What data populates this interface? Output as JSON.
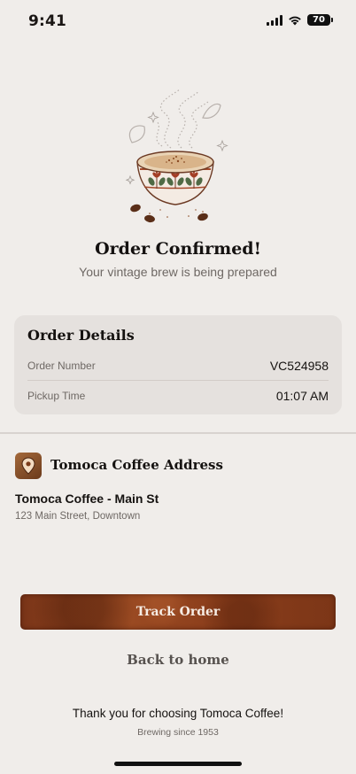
{
  "status_bar": {
    "time": "9:41",
    "battery": "70",
    "icons": [
      "signal-icon",
      "wifi-icon",
      "battery-icon"
    ]
  },
  "hero": {
    "illustration": "coffee-cup-icon",
    "title": "Order Confirmed!",
    "subtitle": "Your vintage brew is being prepared"
  },
  "order_details": {
    "title": "Order Details",
    "rows": [
      {
        "label": "Order Number",
        "value": "VC524958"
      },
      {
        "label": "Pickup Time",
        "value": "01:07 AM"
      }
    ]
  },
  "address": {
    "icon": "location-pin-icon",
    "heading": "Tomoca Coffee Address",
    "name": "Tomoca Coffee - Main St",
    "line": "123 Main Street, Downtown"
  },
  "actions": {
    "track_label": "Track Order",
    "home_label": "Back to home"
  },
  "footer": {
    "thanks": "Thank you for choosing Tomoca Coffee!",
    "since": "Brewing since 1953"
  },
  "colors": {
    "background": "#f0edea",
    "card": "#e5e1de",
    "accent": "#8a3d1b",
    "muted_text": "#6e6864"
  }
}
